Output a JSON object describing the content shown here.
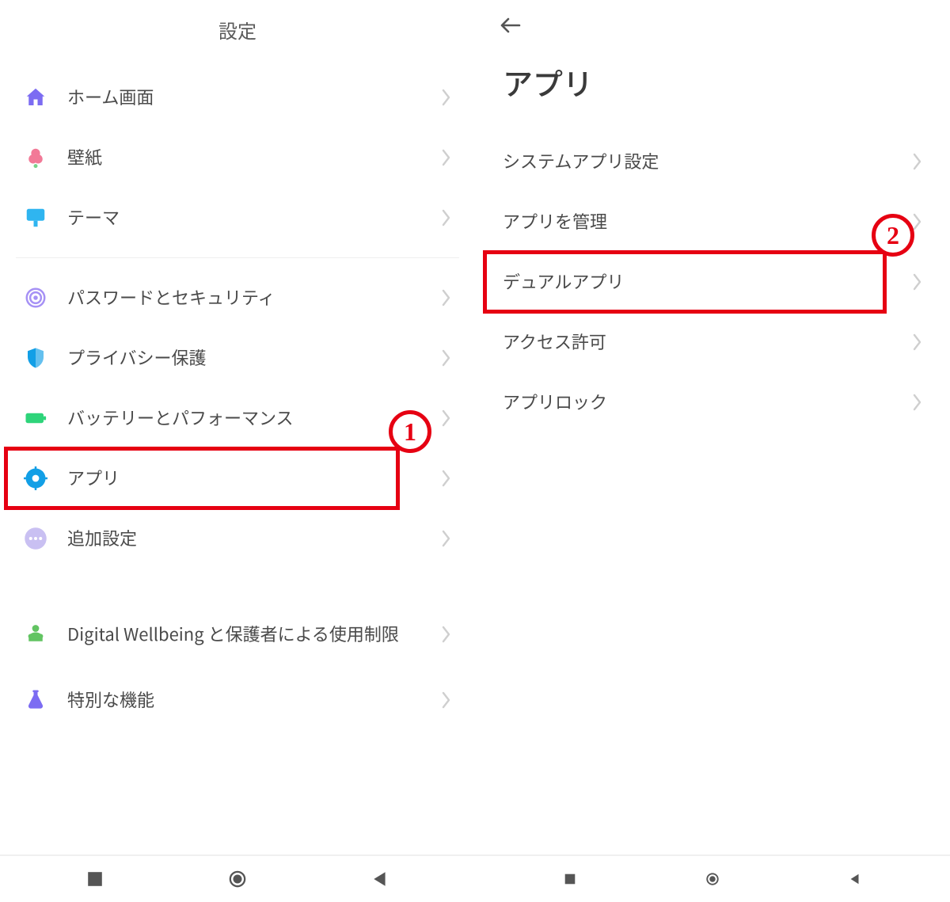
{
  "screen1": {
    "title": "設定",
    "groups": [
      [
        {
          "icon": "home",
          "label": "ホーム画面"
        },
        {
          "icon": "flower",
          "label": "壁紙"
        },
        {
          "icon": "theme",
          "label": "テーマ"
        }
      ],
      [
        {
          "icon": "finger",
          "label": "パスワードとセキュリティ"
        },
        {
          "icon": "shield",
          "label": "プライバシー保護"
        },
        {
          "icon": "battery",
          "label": "バッテリーとパフォーマンス"
        },
        {
          "icon": "gear",
          "label": "アプリ",
          "highlight": true,
          "badge": "1"
        },
        {
          "icon": "dots",
          "label": "追加設定"
        }
      ],
      [
        {
          "icon": "wellbeing",
          "label": "Digital Wellbeing と保護者による使用制限"
        },
        {
          "icon": "flask",
          "label": "特別な機能"
        }
      ]
    ]
  },
  "screen2": {
    "title": "アプリ",
    "items": [
      {
        "label": "システムアプリ設定"
      },
      {
        "label": "アプリを管理"
      },
      {
        "label": "デュアルアプリ",
        "highlight": true,
        "badge": "2"
      },
      {
        "label": "アクセス許可"
      },
      {
        "label": "アプリロック"
      }
    ]
  },
  "annotation": {
    "badge1": "1",
    "badge2": "2"
  }
}
